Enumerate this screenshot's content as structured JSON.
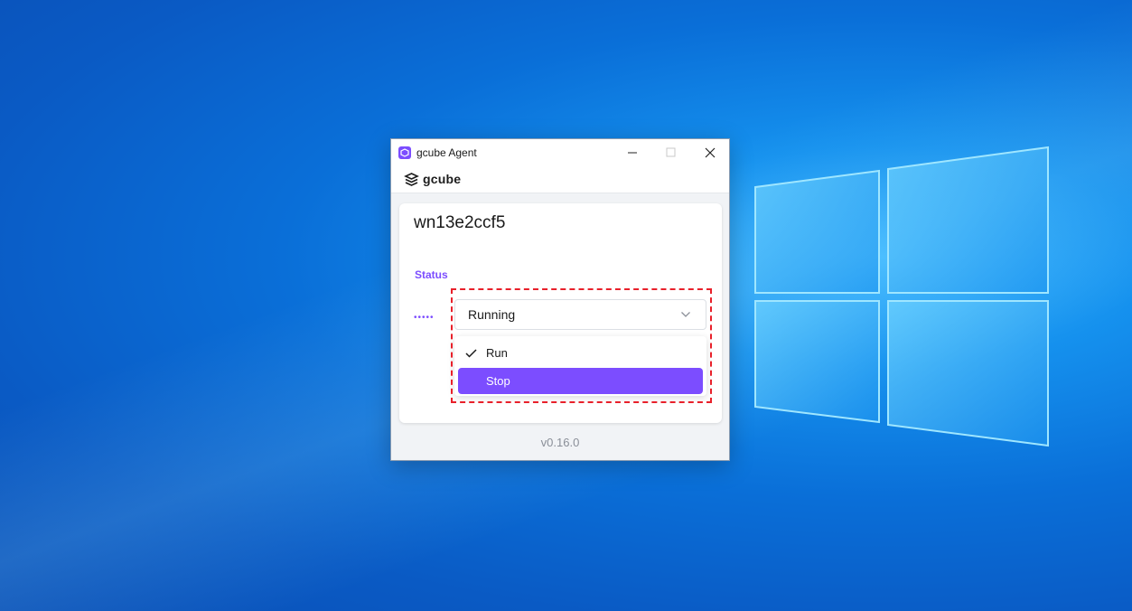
{
  "window": {
    "title": "gcube Agent",
    "brand": "gcube",
    "controls": [
      "minimize-icon",
      "maximize-icon",
      "close-icon"
    ]
  },
  "agent": {
    "hostname": "wn13e2ccf5",
    "status_label": "Status",
    "status_indicator": "•••••",
    "status_value": "Running"
  },
  "dropdown": {
    "options": [
      {
        "label": "Run",
        "checked": true
      },
      {
        "label": "Stop",
        "highlighted": true
      }
    ]
  },
  "footer": {
    "version": "v0.16.0"
  },
  "colors": {
    "accent": "#7c4dff",
    "annotation": "#e8202a",
    "desktop": "#0a6fd8"
  }
}
